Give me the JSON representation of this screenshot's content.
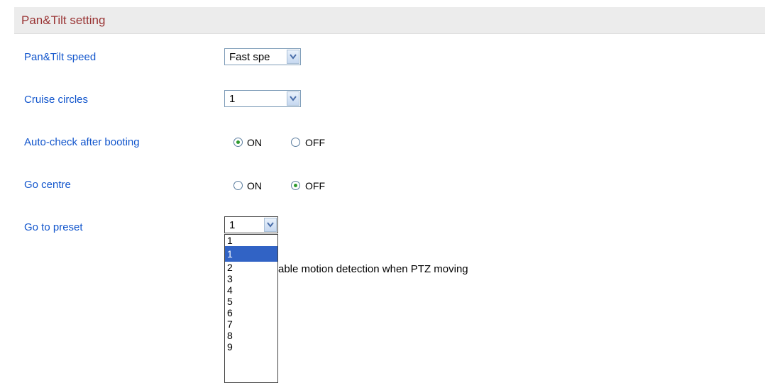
{
  "header": {
    "title": "Pan&Tilt setting"
  },
  "speed": {
    "label": "Pan&Tilt speed",
    "value": "Fast spe"
  },
  "cruise": {
    "label": "Cruise circles",
    "value": "1"
  },
  "autocheck": {
    "label": "Auto-check after booting",
    "on_label": "ON",
    "off_label": "OFF",
    "selected": "ON"
  },
  "centre": {
    "label": "Go centre",
    "on_label": "ON",
    "off_label": "OFF",
    "selected": "OFF"
  },
  "preset": {
    "label": "Go to preset",
    "value": "1",
    "options": [
      "1",
      "2",
      "3",
      "4",
      "5",
      "6",
      "7",
      "8",
      "9"
    ],
    "highlighted": "1"
  },
  "motion": {
    "partial_text": "able motion detection when PTZ moving"
  },
  "colors": {
    "header_text": "#993333",
    "label_text": "#1155cc",
    "highlight": "#3163c5"
  }
}
